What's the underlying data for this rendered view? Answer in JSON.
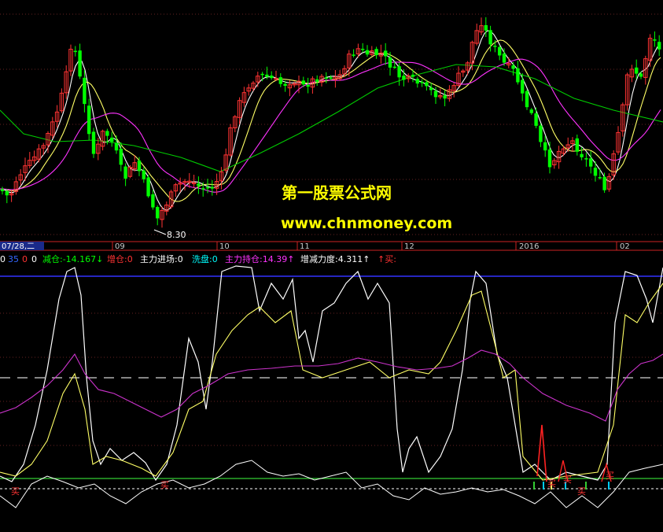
{
  "chart_data": {
    "type": "candlestick",
    "price_panel": {
      "low_label": "8.30",
      "colors": {
        "up": "#ff3333",
        "down": "#00ff00",
        "ma5": "#ffffff",
        "ma10": "#ffff66",
        "ma20": "#ff33ff",
        "ma60": "#00cc00"
      }
    },
    "date_axis": {
      "ticks": [
        "07/28,二",
        "09",
        "10",
        "11",
        "12",
        "2016",
        "02"
      ]
    },
    "legend": [
      {
        "text": "0",
        "color": "#ffffff"
      },
      {
        "text": "35",
        "color": "#3366ff"
      },
      {
        "text": "0",
        "color": "#ff3333"
      },
      {
        "text": "0",
        "color": "#ffffff"
      },
      {
        "text": "减仓:-14.167↓",
        "color": "#00ff00"
      },
      {
        "text": "增仓:0",
        "color": "#ff3333"
      },
      {
        "text": "主力进场:0",
        "color": "#ffffff"
      },
      {
        "text": "洗盘:0",
        "color": "#00ffff"
      },
      {
        "text": "主力持仓:14.39↑",
        "color": "#ff33ff"
      },
      {
        "text": "增减力度:4.311↑",
        "color": "#ffffff"
      },
      {
        "text": "↑买:",
        "color": "#ff3333"
      }
    ],
    "signal_labels": [
      "买",
      "买",
      "买",
      "买",
      "买",
      "买"
    ],
    "watermark": {
      "line1": "第一股票公式网",
      "line2": "www.chnmoney.com"
    },
    "indicator_colors": {
      "white": "#ffffff",
      "yellow": "#ffff66",
      "magenta": "#cc33cc",
      "blue": "#3333ff",
      "green": "#33cc33"
    }
  }
}
